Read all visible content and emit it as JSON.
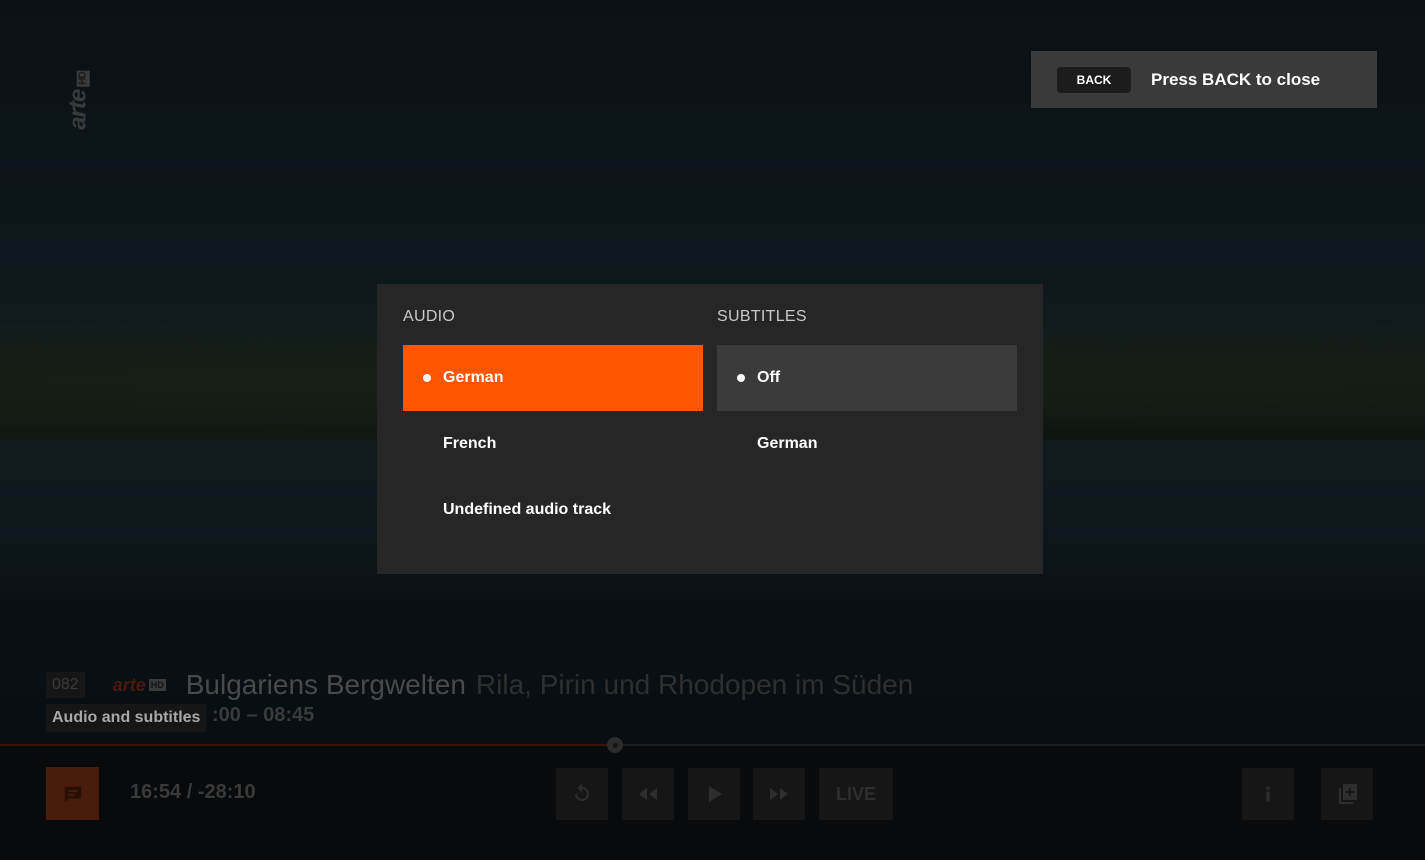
{
  "back_hint": {
    "key_label": "BACK",
    "text": "Press BACK to close"
  },
  "dialog": {
    "audio": {
      "title": "AUDIO",
      "options": [
        {
          "label": "German",
          "selected": true
        },
        {
          "label": "French",
          "selected": false
        },
        {
          "label": "Undefined audio track",
          "selected": false
        }
      ]
    },
    "subtitles": {
      "title": "SUBTITLES",
      "options": [
        {
          "label": "Off",
          "selected": true
        },
        {
          "label": "German",
          "selected": false
        }
      ]
    }
  },
  "program": {
    "channel_number": "082",
    "channel_logo": "arte",
    "channel_logo_hd": "HD",
    "title": "Bulgariens Bergwelten",
    "subtitle": "Rila, Pirin und Rhodopen im Süden",
    "time_range": ":00 – 08:45"
  },
  "tooltip": "Audio and subtitles",
  "playback": {
    "time": "16:54 / -28:10",
    "live_label": "LIVE",
    "progress_fraction": 0.43
  },
  "colors": {
    "accent": "#ff5500",
    "selected_grey": "#3b3b3b",
    "dialog_bg": "#262626"
  },
  "icons": [
    "subtitles-icon",
    "replay-icon",
    "rewind-icon",
    "play-icon",
    "fast-forward-icon",
    "info-icon",
    "add-to-list-icon"
  ]
}
